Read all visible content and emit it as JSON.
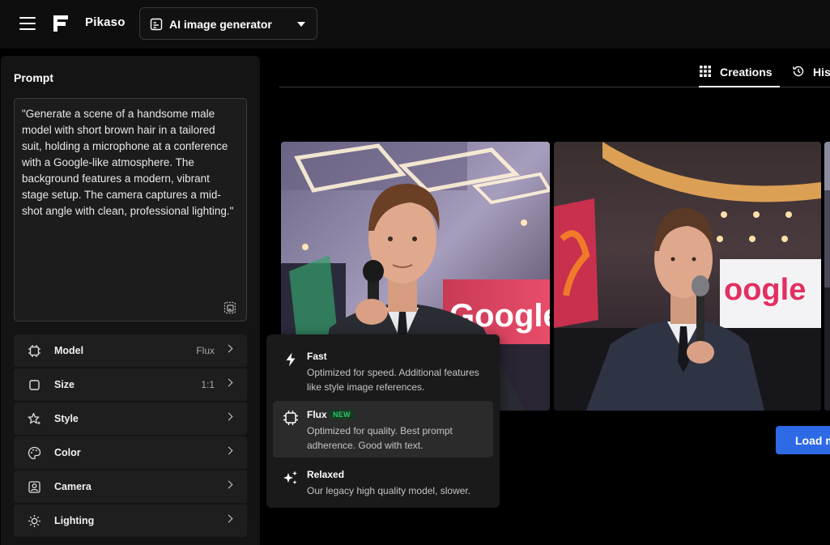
{
  "header": {
    "brand": "Pikaso",
    "tool_selector": {
      "label": "AI image generator"
    }
  },
  "prompt": {
    "title": "Prompt",
    "text": "\"Generate a scene of a handsome male model with short brown hair in a tailored suit, holding a microphone at a conference with a Google-like atmosphere. The background features a modern, vibrant stage setup. The camera captures a mid-shot angle with clean, professional lighting.\""
  },
  "options": [
    {
      "label": "Model",
      "value": "Flux",
      "icon": "chip-icon"
    },
    {
      "label": "Size",
      "value": "1:1",
      "icon": "square-icon"
    },
    {
      "label": "Style",
      "value": "",
      "icon": "sparkle-star-icon"
    },
    {
      "label": "Color",
      "value": "",
      "icon": "palette-icon"
    },
    {
      "label": "Camera",
      "value": "",
      "icon": "camera-icon"
    },
    {
      "label": "Lighting",
      "value": "",
      "icon": "sun-icon"
    }
  ],
  "tabs": [
    {
      "label": "Creations",
      "icon": "grid-icon",
      "active": true
    },
    {
      "label": "Hist",
      "icon": "history-icon",
      "active": false
    }
  ],
  "gallery": {
    "sign_text": "Google",
    "sign_text_2": "oogle"
  },
  "load_more": "Load m",
  "model_dropdown": {
    "items": [
      {
        "name": "Fast",
        "description": "Optimized for speed. Additional features like style image references.",
        "icon": "lightning-icon",
        "selected": false
      },
      {
        "name": "Flux",
        "badge": "NEW",
        "description": "Optimized for quality. Best prompt adherence. Good with text.",
        "icon": "chip-icon",
        "selected": true
      },
      {
        "name": "Relaxed",
        "description": "Our legacy high quality model, slower.",
        "icon": "sparkles-icon",
        "selected": false
      }
    ]
  },
  "colors": {
    "accent": "#2f6ae6",
    "panel": "#141414",
    "new_badge": "#2fc466"
  }
}
